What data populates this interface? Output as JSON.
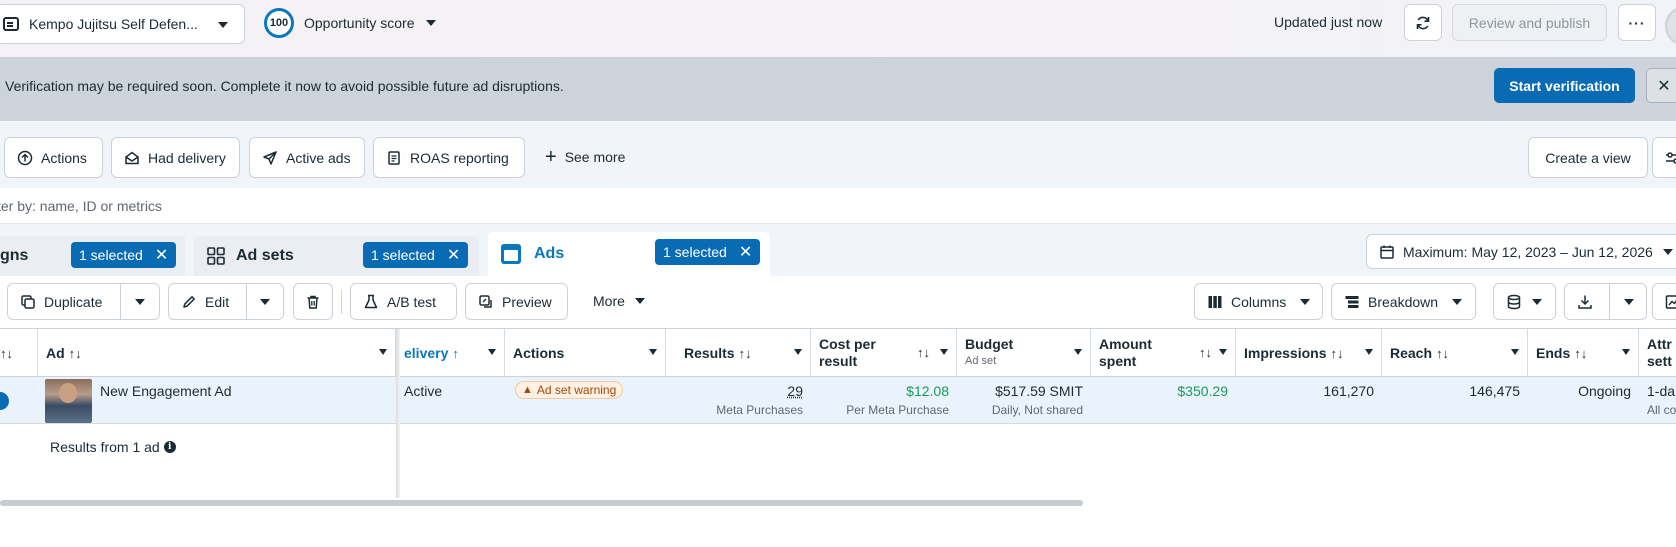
{
  "topbar": {
    "account_name": "Kempo Jujitsu Self Defen...",
    "opportunity_score_value": "100",
    "opportunity_score_label": "Opportunity score",
    "updated_text": "Updated just now",
    "review_publish_label": "Review and publish",
    "more_label": "···"
  },
  "banner": {
    "message": "Verification may be required soon. Complete it now to avoid possible future ad disruptions.",
    "button_label": "Start verification",
    "close_label": "✕"
  },
  "chips": {
    "items": [
      {
        "label": "Actions",
        "icon": "arrow-up-circle-icon"
      },
      {
        "label": "Had delivery",
        "icon": "envelope-open-icon"
      },
      {
        "label": "Active ads",
        "icon": "send-icon"
      },
      {
        "label": "ROAS reporting",
        "icon": "report-icon"
      }
    ],
    "see_more_label": "See more",
    "create_view_label": "Create a view"
  },
  "search": {
    "placeholder": "ter by: name, ID or metrics"
  },
  "tabs": {
    "campaigns_label": "gns",
    "campaigns_selected": "1 selected",
    "adsets_label": "Ad sets",
    "adsets_selected": "1 selected",
    "ads_label": "Ads",
    "ads_selected": "1 selected",
    "date_range": "Maximum: May 12, 2023 – Jun 12, 2026"
  },
  "toolbar": {
    "duplicate_label": "Duplicate",
    "edit_label": "Edit",
    "ab_test_label": "A/B test",
    "preview_label": "Preview",
    "more_label": "More",
    "columns_label": "Columns",
    "breakdown_label": "Breakdown"
  },
  "table": {
    "headers": {
      "ad": "Ad",
      "delivery": "elivery",
      "actions": "Actions",
      "results": "Results",
      "cost_per_result_1": "Cost per",
      "cost_per_result_2": "result",
      "budget": "Budget",
      "budget_sub": "Ad set",
      "amount_spent_1": "Amount",
      "amount_spent_2": "spent",
      "impressions": "Impressions",
      "reach": "Reach",
      "ends": "Ends",
      "attribution_1": "Attr",
      "attribution_2": "sett"
    },
    "row": {
      "ad_name": "New Engagement Ad",
      "delivery": "Active",
      "actions_badge": "Ad set warning",
      "results": "29",
      "results_sub": "Meta Purchases",
      "cost_per_result": "$12.08",
      "cost_per_result_sub": "Per Meta Purchase",
      "budget": "$517.59 SMIT",
      "budget_sub": "Daily, Not shared",
      "amount_spent": "$350.29",
      "impressions": "161,270",
      "reach": "146,475",
      "ends": "Ongoing",
      "attribution": "1-da",
      "attribution_sub": "All co"
    },
    "footer_text": "Results from 1 ad",
    "info_icon": "i"
  },
  "colors": {
    "accent_blue": "#0a6bb5",
    "green_value": "#1a9a5b",
    "banner_bg": "#cdd3da",
    "warn_text": "#a2480a"
  }
}
